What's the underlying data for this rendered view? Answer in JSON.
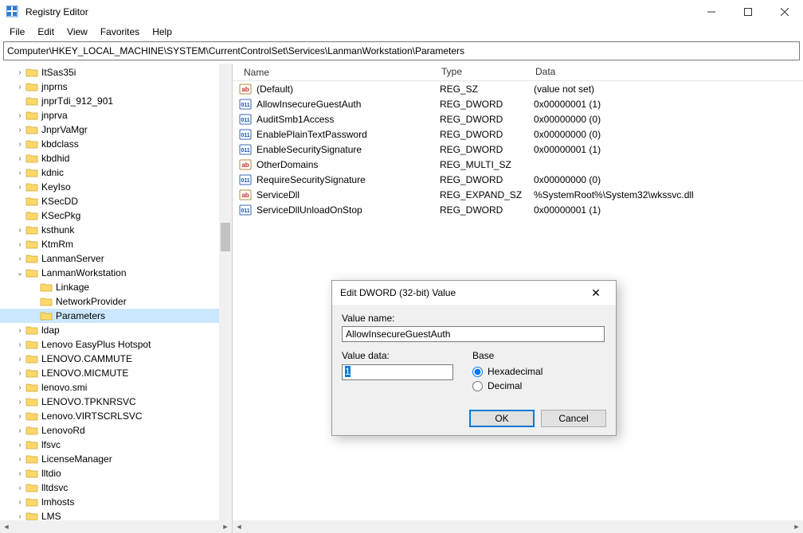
{
  "window": {
    "title": "Registry Editor"
  },
  "menu": [
    "File",
    "Edit",
    "View",
    "Favorites",
    "Help"
  ],
  "address": "Computer\\HKEY_LOCAL_MACHINE\\SYSTEM\\CurrentControlSet\\Services\\LanmanWorkstation\\Parameters",
  "tree": [
    {
      "indent": 1,
      "twisty": ">",
      "label": "ItSas35i"
    },
    {
      "indent": 1,
      "twisty": ">",
      "label": "jnprns"
    },
    {
      "indent": 1,
      "twisty": "",
      "label": "jnprTdi_912_901"
    },
    {
      "indent": 1,
      "twisty": ">",
      "label": "jnprva"
    },
    {
      "indent": 1,
      "twisty": ">",
      "label": "JnprVaMgr"
    },
    {
      "indent": 1,
      "twisty": ">",
      "label": "kbdclass"
    },
    {
      "indent": 1,
      "twisty": ">",
      "label": "kbdhid"
    },
    {
      "indent": 1,
      "twisty": ">",
      "label": "kdnic"
    },
    {
      "indent": 1,
      "twisty": ">",
      "label": "KeyIso"
    },
    {
      "indent": 1,
      "twisty": "",
      "label": "KSecDD"
    },
    {
      "indent": 1,
      "twisty": "",
      "label": "KSecPkg"
    },
    {
      "indent": 1,
      "twisty": ">",
      "label": "ksthunk"
    },
    {
      "indent": 1,
      "twisty": ">",
      "label": "KtmRm"
    },
    {
      "indent": 1,
      "twisty": ">",
      "label": "LanmanServer"
    },
    {
      "indent": 1,
      "twisty": "v",
      "label": "LanmanWorkstation"
    },
    {
      "indent": 2,
      "twisty": "",
      "label": "Linkage"
    },
    {
      "indent": 2,
      "twisty": "",
      "label": "NetworkProvider"
    },
    {
      "indent": 2,
      "twisty": "",
      "label": "Parameters",
      "selected": true
    },
    {
      "indent": 1,
      "twisty": ">",
      "label": "ldap"
    },
    {
      "indent": 1,
      "twisty": ">",
      "label": "Lenovo EasyPlus Hotspot"
    },
    {
      "indent": 1,
      "twisty": ">",
      "label": "LENOVO.CAMMUTE"
    },
    {
      "indent": 1,
      "twisty": ">",
      "label": "LENOVO.MICMUTE"
    },
    {
      "indent": 1,
      "twisty": ">",
      "label": "lenovo.smi"
    },
    {
      "indent": 1,
      "twisty": ">",
      "label": "LENOVO.TPKNRSVC"
    },
    {
      "indent": 1,
      "twisty": ">",
      "label": "Lenovo.VIRTSCRLSVC"
    },
    {
      "indent": 1,
      "twisty": ">",
      "label": "LenovoRd"
    },
    {
      "indent": 1,
      "twisty": ">",
      "label": "lfsvc"
    },
    {
      "indent": 1,
      "twisty": ">",
      "label": "LicenseManager"
    },
    {
      "indent": 1,
      "twisty": ">",
      "label": "lltdio"
    },
    {
      "indent": 1,
      "twisty": ">",
      "label": "lltdsvc"
    },
    {
      "indent": 1,
      "twisty": ">",
      "label": "lmhosts"
    },
    {
      "indent": 1,
      "twisty": ">",
      "label": "LMS"
    }
  ],
  "list": {
    "columns": [
      "Name",
      "Type",
      "Data"
    ],
    "rows": [
      {
        "icon": "sz",
        "name": "(Default)",
        "type": "REG_SZ",
        "data": "(value not set)"
      },
      {
        "icon": "dw",
        "name": "AllowInsecureGuestAuth",
        "type": "REG_DWORD",
        "data": "0x00000001 (1)"
      },
      {
        "icon": "dw",
        "name": "AuditSmb1Access",
        "type": "REG_DWORD",
        "data": "0x00000000 (0)"
      },
      {
        "icon": "dw",
        "name": "EnablePlainTextPassword",
        "type": "REG_DWORD",
        "data": "0x00000000 (0)"
      },
      {
        "icon": "dw",
        "name": "EnableSecuritySignature",
        "type": "REG_DWORD",
        "data": "0x00000001 (1)"
      },
      {
        "icon": "sz",
        "name": "OtherDomains",
        "type": "REG_MULTI_SZ",
        "data": ""
      },
      {
        "icon": "dw",
        "name": "RequireSecuritySignature",
        "type": "REG_DWORD",
        "data": "0x00000000 (0)"
      },
      {
        "icon": "sz",
        "name": "ServiceDll",
        "type": "REG_EXPAND_SZ",
        "data": "%SystemRoot%\\System32\\wkssvc.dll"
      },
      {
        "icon": "dw",
        "name": "ServiceDllUnloadOnStop",
        "type": "REG_DWORD",
        "data": "0x00000001 (1)"
      }
    ]
  },
  "dialog": {
    "title": "Edit DWORD (32-bit) Value",
    "value_name_label": "Value name:",
    "value_name": "AllowInsecureGuestAuth",
    "value_data_label": "Value data:",
    "value_data": "1",
    "base_label": "Base",
    "hex_label": "Hexadecimal",
    "dec_label": "Decimal",
    "ok": "OK",
    "cancel": "Cancel"
  }
}
